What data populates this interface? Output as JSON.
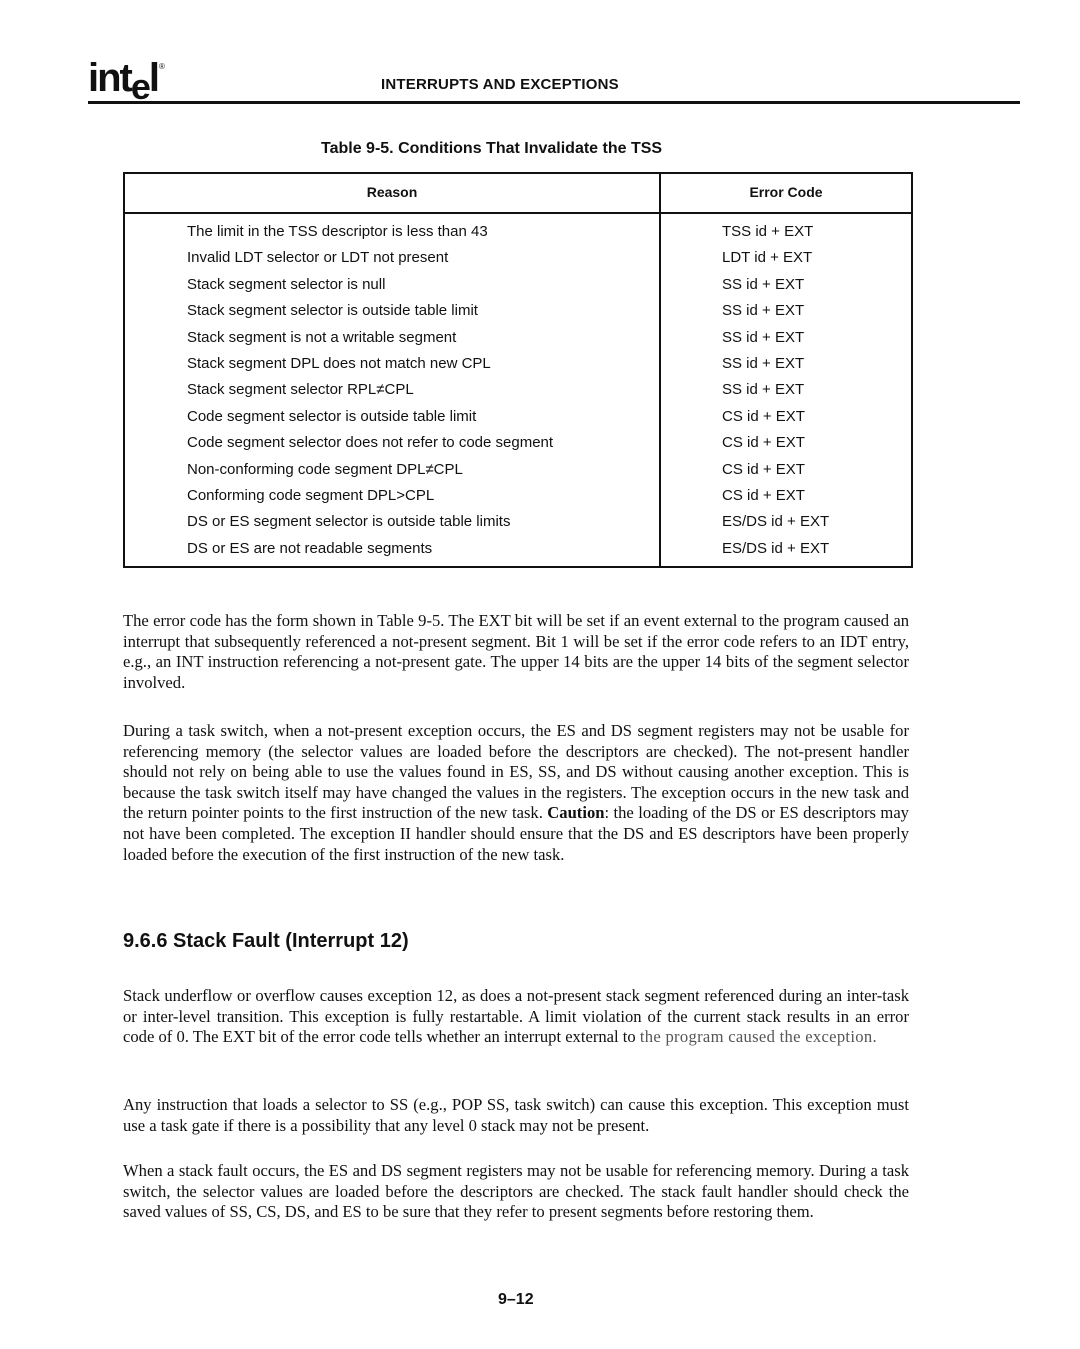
{
  "header": {
    "logo_text": "intel",
    "running_head": "INTERRUPTS AND EXCEPTIONS"
  },
  "table": {
    "title": "Table 9-5.  Conditions That Invalidate the TSS",
    "columns": [
      "Reason",
      "Error Code"
    ],
    "rows": [
      {
        "reason": "The limit in the TSS descriptor is less than 43",
        "code": "TSS id + EXT"
      },
      {
        "reason": "Invalid LDT selector or LDT not present",
        "code": "LDT id + EXT"
      },
      {
        "reason": "Stack segment selector is null",
        "code": "SS id + EXT"
      },
      {
        "reason": "Stack segment selector is outside table limit",
        "code": "SS id + EXT"
      },
      {
        "reason": "Stack segment is not a writable segment",
        "code": "SS id + EXT"
      },
      {
        "reason": "Stack segment DPL does not match new CPL",
        "code": "SS id + EXT"
      },
      {
        "reason": "Stack segment selector RPL≠CPL",
        "code": "SS id + EXT"
      },
      {
        "reason": "Code segment selector is outside table limit",
        "code": "CS id + EXT"
      },
      {
        "reason": "Code segment selector does not refer to code segment",
        "code": "CS id + EXT"
      },
      {
        "reason": "Non-conforming code segment DPL≠CPL",
        "code": "CS id + EXT"
      },
      {
        "reason": "Conforming code segment DPL>CPL",
        "code": "CS id + EXT"
      },
      {
        "reason": "DS or ES segment selector is outside table limits",
        "code": "ES/DS id + EXT"
      },
      {
        "reason": "DS or ES are not readable segments",
        "code": "ES/DS id + EXT"
      }
    ]
  },
  "body": {
    "p1": "The error code has the form shown in Table 9-5. The EXT bit will be set if an event external to the program caused an interrupt that subsequently referenced a not-present segment. Bit 1 will be set if the error code refers to an IDT entry, e.g., an INT instruction referencing a not-present gate. The upper 14 bits are the upper 14 bits of the segment selector involved.",
    "p2_before": "During a task switch, when a not-present exception occurs, the ES and DS segment registers may not be usable for referencing memory (the selector values are loaded before the descriptors are checked). The not-present handler should not rely on being able to use the values found in ES, SS, and DS without causing another exception. This is because the task switch itself may have changed the values in the registers. The exception occurs in the new task and the return pointer points to the first instruction of the new task. ",
    "p2_bold": "Caution",
    "p2_after": ": the loading of the DS or ES descriptors may not have been completed. The exception II handler should ensure that the DS and ES descriptors have been properly loaded before the execution of the first instruction of the new task.",
    "section_heading": "9.6.6  Stack Fault (Interrupt 12)",
    "p3_main": "Stack underflow or overflow causes exception 12, as does a not-present stack segment referenced during an inter-task or inter-level transition. This exception is fully restartable. A limit violation of the current stack results in an error code of 0. The EXT bit of the error code tells whether an interrupt external to ",
    "p3_faded": "the program caused the exception.",
    "p4": "Any instruction that loads a selector to SS (e.g., POP SS, task switch) can cause this exception. This exception must use a task gate if there is a possibility that any level 0 stack may not be present.",
    "p5": "When a stack fault occurs, the ES and DS segment registers may not be usable for referencing memory. During a task switch, the selector values are loaded before the descriptors are checked. The stack fault handler should check the saved values of SS, CS, DS, and ES to be sure that they refer to present segments before restoring them."
  },
  "footer": {
    "page_number": "9–12"
  }
}
